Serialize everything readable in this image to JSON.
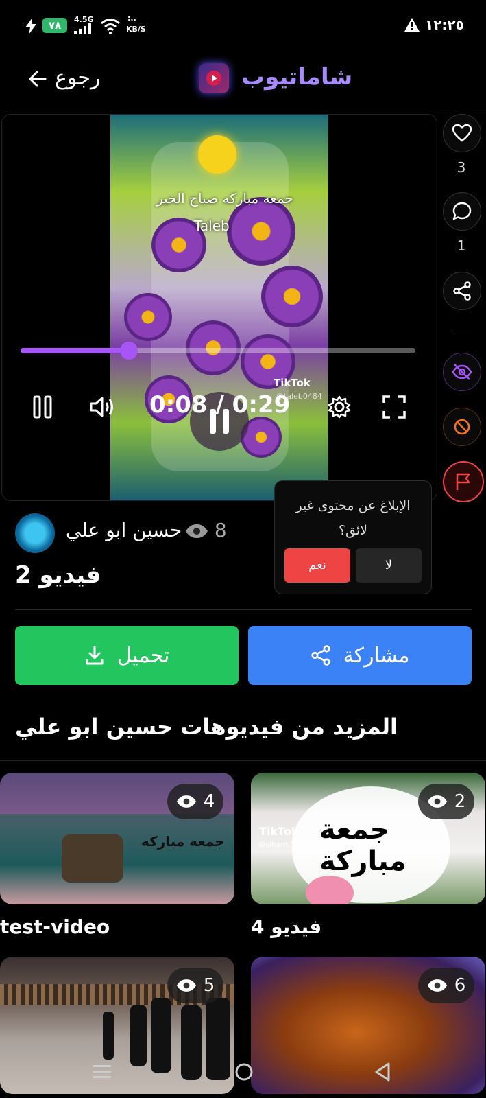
{
  "status_bar": {
    "battery": "٧٨",
    "network": "4.5G",
    "speed_value": ":..",
    "speed_unit": "KB/S",
    "time": "١٢:٢٥"
  },
  "header": {
    "back_label": "رجوع",
    "app_title": "شاماتيوب"
  },
  "player": {
    "overlay_text": "جمعه مباركه صباح الخير",
    "overlay_name": "Taleb",
    "tiktok_label": "TikTok",
    "tiktok_handle": "@taleb0484",
    "time_display": "0:08 / 0:29",
    "progress_fraction": 0.275
  },
  "side_actions": {
    "likes_count": "3",
    "comments_count": "1"
  },
  "report_popup": {
    "question": "الإبلاغ عن محتوى غير لائق؟",
    "no_label": "لا",
    "yes_label": "نعم"
  },
  "video_info": {
    "author": "حسين ابو علي",
    "views": "8",
    "title": "فيديو 2"
  },
  "actions": {
    "download_label": "تحميل",
    "share_label": "مشاركة"
  },
  "more": {
    "title": "المزيد من فيديوهات حسين ابو علي",
    "videos": [
      {
        "views": "4",
        "title": "test-video",
        "overlay": "جمعه مباركه"
      },
      {
        "views": "2",
        "title": "فيديو 4",
        "overlay": "جمعة مباركة",
        "tiktok_label": "TikTok",
        "tiktok_handle": "@siham.1234560"
      },
      {
        "views": "5",
        "title": ""
      },
      {
        "views": "6",
        "title": ""
      }
    ]
  },
  "colors": {
    "accent_purple": "#a855f7",
    "download_green": "#22c55e",
    "share_blue": "#3b82f6",
    "report_red": "#ef4444"
  }
}
